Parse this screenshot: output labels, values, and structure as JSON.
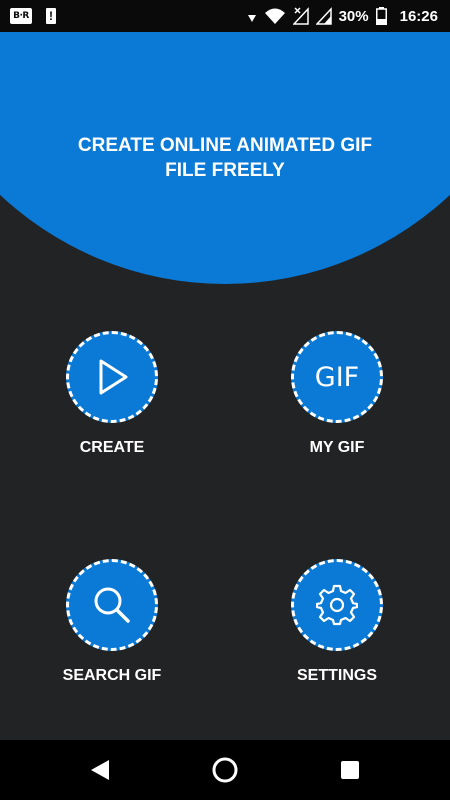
{
  "status_bar": {
    "app_badge": "B·R",
    "alert_badge": "!",
    "battery_percent": "30%",
    "time": "16:26",
    "icons": [
      "wifi-icon",
      "signal-x-icon",
      "signal-icon",
      "signal-icon",
      "battery-icon"
    ]
  },
  "header": {
    "title": "CREATE ONLINE ANIMATED GIF\nFILE FREELY"
  },
  "menu": {
    "create": {
      "label": "CREATE",
      "icon": "play-icon"
    },
    "my_gif": {
      "label": "MY GIF",
      "icon_text": "GIF"
    },
    "search_gif": {
      "label": "SEARCH GIF",
      "icon": "search-icon"
    },
    "settings": {
      "label": "SETTINGS",
      "icon": "gear-icon"
    }
  },
  "nav": {
    "back": "back-icon",
    "home": "home-icon",
    "recents": "recents-icon"
  },
  "colors": {
    "accent": "#0a7ad6",
    "background": "#222324",
    "status_bar": "#0a0a0a",
    "nav_bar": "#000000"
  }
}
